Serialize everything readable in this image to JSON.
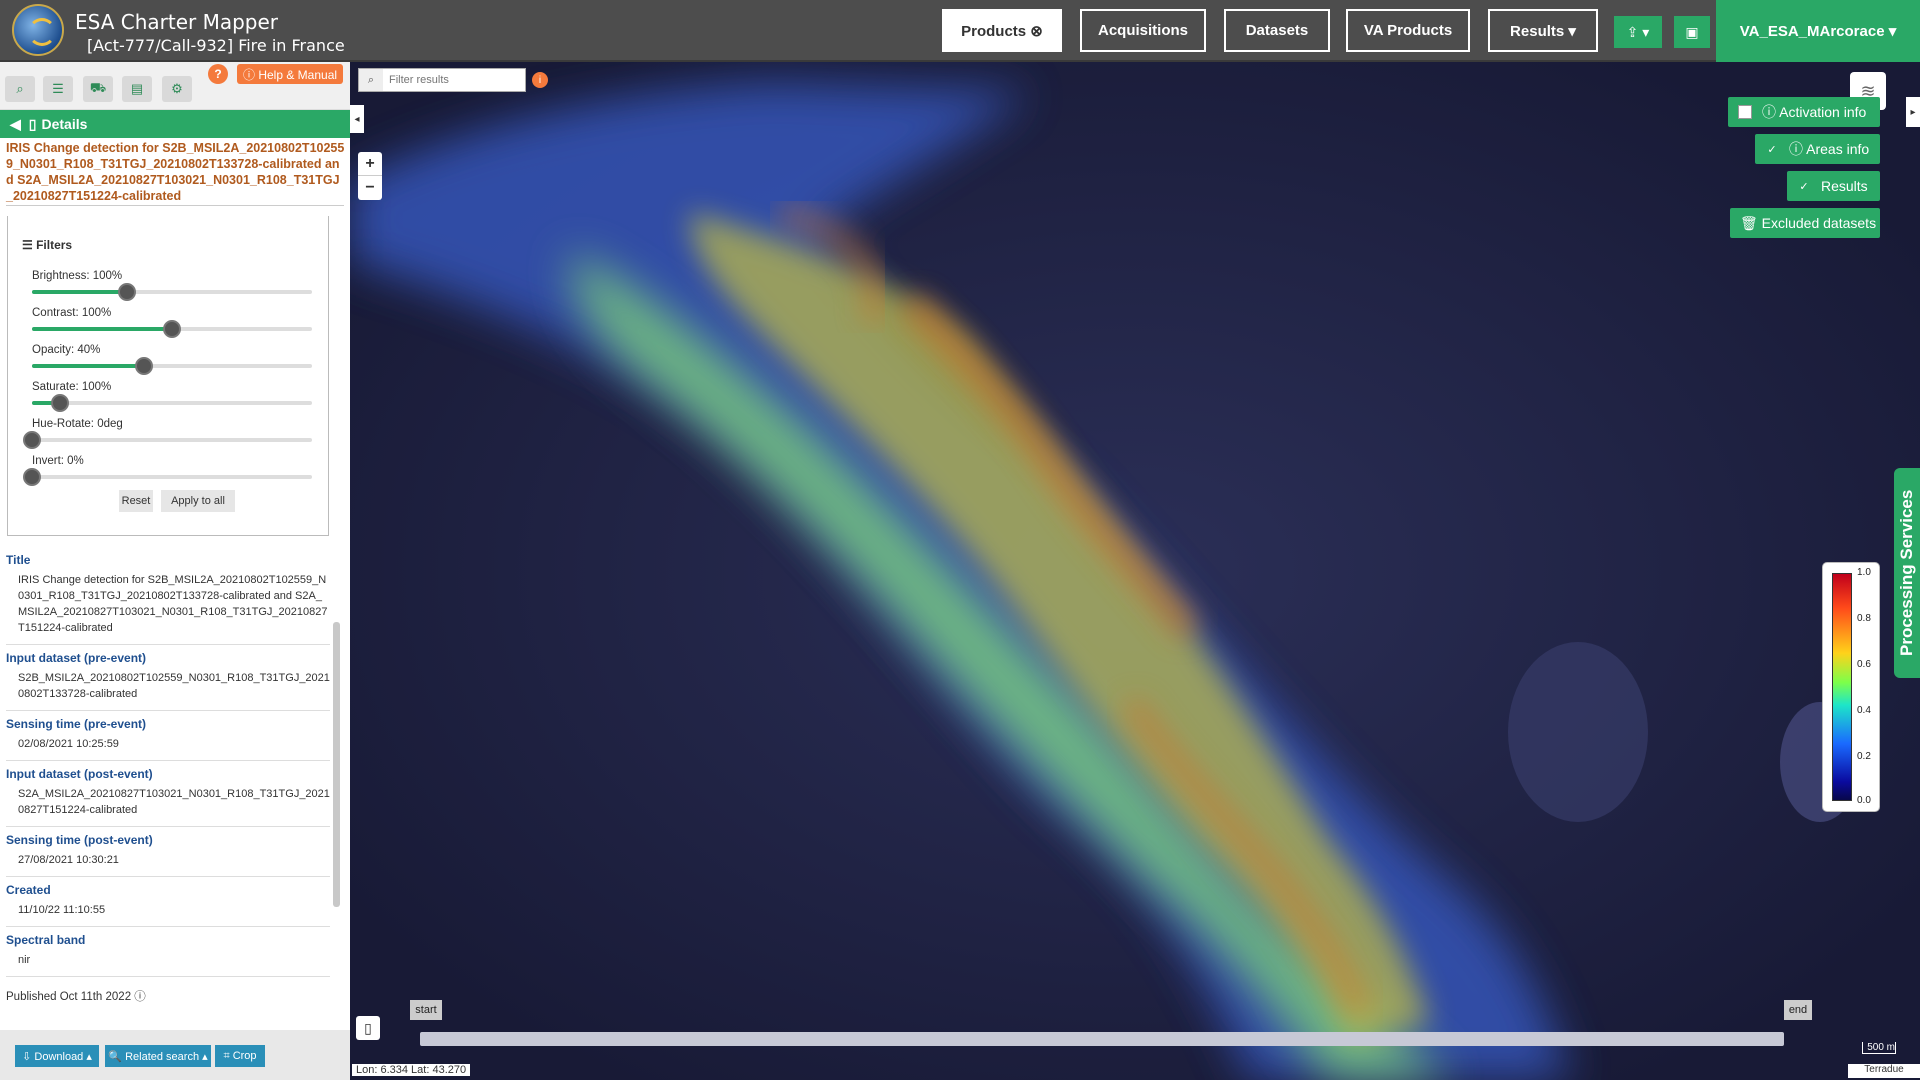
{
  "header": {
    "app_title": "ESA Charter Mapper",
    "subtitle": "[Act-777/Call-932] Fire in France",
    "nav": {
      "products": "Products ⊗",
      "acquisitions": "Acquisitions",
      "datasets": "Datasets",
      "va_products": "VA Products",
      "results": "Results ▾"
    },
    "upload_icon": "⇪ ▾",
    "briefcase_icon": "▣",
    "user": "VA_ESA_MArcorace ▾"
  },
  "sidebar": {
    "tools": [
      "search-icon",
      "list-icon",
      "basket-icon",
      "archive-icon",
      "gear-icon"
    ],
    "help_q": "?",
    "help_manual": "ⓘ Help & Manual",
    "details_label": "Details",
    "product_title": "IRIS Change detection for S2B_MSIL2A_20210802T102559_N0301_R108_T31TGJ_20210802T133728-calibrated and S2A_MSIL2A_20210827T103021_N0301_R108_T31TGJ_20210827T151224-calibrated",
    "filters": {
      "title": "☰ Filters",
      "brightness": {
        "label": "Brightness: 100%",
        "value": 0.34
      },
      "contrast": {
        "label": "Contrast: 100%",
        "value": 0.5
      },
      "opacity": {
        "label": "Opacity: 40%",
        "value": 0.4
      },
      "saturate": {
        "label": "Saturate: 100%",
        "value": 0.1
      },
      "hue": {
        "label": "Hue-Rotate: 0deg",
        "value": 0.0
      },
      "invert": {
        "label": "Invert: 0%",
        "value": 0.0
      },
      "reset": "Reset",
      "apply": "Apply to all"
    },
    "meta": {
      "title_key": "Title",
      "title_val": "IRIS Change detection for S2B_MSIL2A_20210802T102559_N0301_R108_T31TGJ_20210802T133728-calibrated and S2A_MSIL2A_20210827T103021_N0301_R108_T31TGJ_20210827T151224-calibrated",
      "pre_key": "Input dataset (pre-event)",
      "pre_val": "S2B_MSIL2A_20210802T102559_N0301_R108_T31TGJ_20210802T133728-calibrated",
      "pre_time_key": "Sensing time (pre-event)",
      "pre_time_val": "02/08/2021 10:25:59",
      "post_key": "Input dataset (post-event)",
      "post_val": "S2A_MSIL2A_20210827T103021_N0301_R108_T31TGJ_20210827T151224-calibrated",
      "post_time_key": "Sensing time (post-event)",
      "post_time_val": "27/08/2021 10:30:21",
      "created_key": "Created",
      "created_val": "11/10/22 11:10:55",
      "band_key": "Spectral band",
      "band_val": "nir"
    },
    "published": "Published Oct 11th 2022 ⓘ",
    "actions": {
      "download": "⇩ Download ▴",
      "related": "🔍 Related search ▴",
      "crop": "⌗ Crop"
    }
  },
  "map": {
    "search_placeholder": "Filter results",
    "search_info": "i",
    "zoom_in": "+",
    "zoom_out": "−",
    "layers_icon": "≋",
    "activation_info": "ⓘ Activation info",
    "areas_info": "ⓘ Areas info",
    "results": "Results",
    "excluded": "🗑 Excluded datasets",
    "processing_services": "Processing Services",
    "legend_ticks": [
      "1.0",
      "0.8",
      "0.6",
      "0.4",
      "0.2",
      "0.0"
    ],
    "timeline_start": "start",
    "timeline_end": "end",
    "coords": "Lon: 6.334 Lat: 43.270",
    "scale": "500 m",
    "attribution": "Terradue"
  }
}
